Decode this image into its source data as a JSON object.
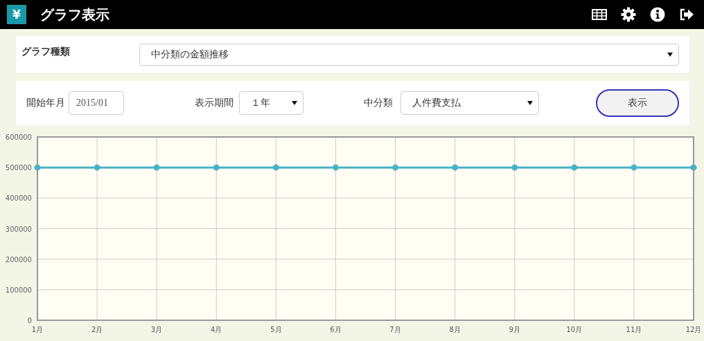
{
  "header": {
    "logo": "¥",
    "title": "グラフ表示"
  },
  "graph_type": {
    "label": "グラフ種類",
    "value": "中分類の金額推移"
  },
  "filters": {
    "start_label": "開始年月",
    "start_value": "2015/01",
    "period_label": "表示期間",
    "period_value": "１年",
    "category_label": "中分類",
    "category_value": "人件費支払",
    "submit": "表示"
  },
  "chart_data": {
    "type": "line",
    "categories": [
      "1月",
      "2月",
      "3月",
      "4月",
      "5月",
      "6月",
      "7月",
      "8月",
      "9月",
      "10月",
      "11月",
      "12月"
    ],
    "grid": true,
    "series": [
      {
        "color": "#4bb2c5",
        "marker": "circle",
        "values": [
          500000,
          500000,
          500000,
          500000,
          500000,
          500000,
          500000,
          500000,
          500000,
          500000,
          500000,
          500000
        ]
      }
    ],
    "ylim": [
      0,
      600000
    ],
    "yticks": [
      0,
      100000,
      200000,
      300000,
      400000,
      500000,
      600000
    ]
  }
}
